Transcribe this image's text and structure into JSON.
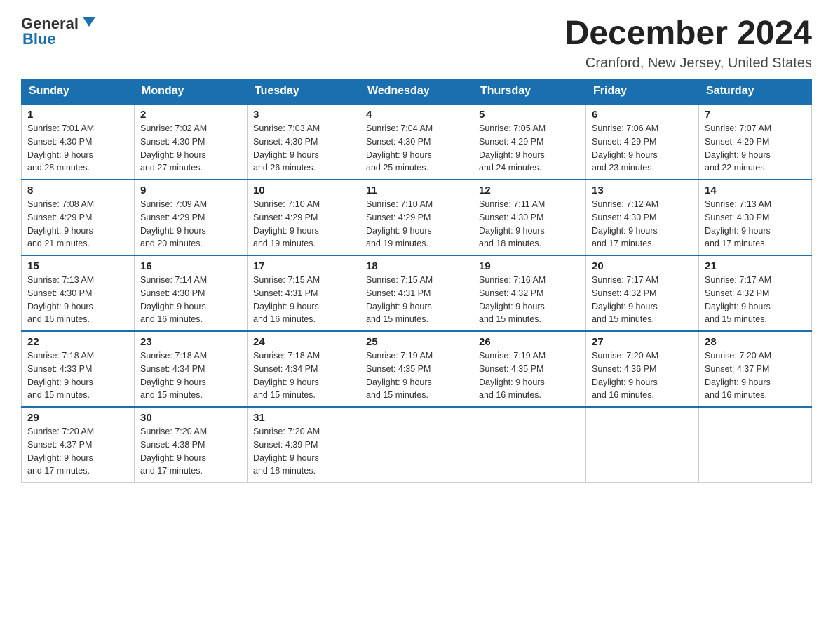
{
  "logo": {
    "general": "General",
    "blue": "Blue"
  },
  "title": "December 2024",
  "location": "Cranford, New Jersey, United States",
  "days_of_week": [
    "Sunday",
    "Monday",
    "Tuesday",
    "Wednesday",
    "Thursday",
    "Friday",
    "Saturday"
  ],
  "weeks": [
    [
      {
        "day": "1",
        "sunrise": "Sunrise: 7:01 AM",
        "sunset": "Sunset: 4:30 PM",
        "daylight": "Daylight: 9 hours",
        "daylight2": "and 28 minutes."
      },
      {
        "day": "2",
        "sunrise": "Sunrise: 7:02 AM",
        "sunset": "Sunset: 4:30 PM",
        "daylight": "Daylight: 9 hours",
        "daylight2": "and 27 minutes."
      },
      {
        "day": "3",
        "sunrise": "Sunrise: 7:03 AM",
        "sunset": "Sunset: 4:30 PM",
        "daylight": "Daylight: 9 hours",
        "daylight2": "and 26 minutes."
      },
      {
        "day": "4",
        "sunrise": "Sunrise: 7:04 AM",
        "sunset": "Sunset: 4:30 PM",
        "daylight": "Daylight: 9 hours",
        "daylight2": "and 25 minutes."
      },
      {
        "day": "5",
        "sunrise": "Sunrise: 7:05 AM",
        "sunset": "Sunset: 4:29 PM",
        "daylight": "Daylight: 9 hours",
        "daylight2": "and 24 minutes."
      },
      {
        "day": "6",
        "sunrise": "Sunrise: 7:06 AM",
        "sunset": "Sunset: 4:29 PM",
        "daylight": "Daylight: 9 hours",
        "daylight2": "and 23 minutes."
      },
      {
        "day": "7",
        "sunrise": "Sunrise: 7:07 AM",
        "sunset": "Sunset: 4:29 PM",
        "daylight": "Daylight: 9 hours",
        "daylight2": "and 22 minutes."
      }
    ],
    [
      {
        "day": "8",
        "sunrise": "Sunrise: 7:08 AM",
        "sunset": "Sunset: 4:29 PM",
        "daylight": "Daylight: 9 hours",
        "daylight2": "and 21 minutes."
      },
      {
        "day": "9",
        "sunrise": "Sunrise: 7:09 AM",
        "sunset": "Sunset: 4:29 PM",
        "daylight": "Daylight: 9 hours",
        "daylight2": "and 20 minutes."
      },
      {
        "day": "10",
        "sunrise": "Sunrise: 7:10 AM",
        "sunset": "Sunset: 4:29 PM",
        "daylight": "Daylight: 9 hours",
        "daylight2": "and 19 minutes."
      },
      {
        "day": "11",
        "sunrise": "Sunrise: 7:10 AM",
        "sunset": "Sunset: 4:29 PM",
        "daylight": "Daylight: 9 hours",
        "daylight2": "and 19 minutes."
      },
      {
        "day": "12",
        "sunrise": "Sunrise: 7:11 AM",
        "sunset": "Sunset: 4:30 PM",
        "daylight": "Daylight: 9 hours",
        "daylight2": "and 18 minutes."
      },
      {
        "day": "13",
        "sunrise": "Sunrise: 7:12 AM",
        "sunset": "Sunset: 4:30 PM",
        "daylight": "Daylight: 9 hours",
        "daylight2": "and 17 minutes."
      },
      {
        "day": "14",
        "sunrise": "Sunrise: 7:13 AM",
        "sunset": "Sunset: 4:30 PM",
        "daylight": "Daylight: 9 hours",
        "daylight2": "and 17 minutes."
      }
    ],
    [
      {
        "day": "15",
        "sunrise": "Sunrise: 7:13 AM",
        "sunset": "Sunset: 4:30 PM",
        "daylight": "Daylight: 9 hours",
        "daylight2": "and 16 minutes."
      },
      {
        "day": "16",
        "sunrise": "Sunrise: 7:14 AM",
        "sunset": "Sunset: 4:30 PM",
        "daylight": "Daylight: 9 hours",
        "daylight2": "and 16 minutes."
      },
      {
        "day": "17",
        "sunrise": "Sunrise: 7:15 AM",
        "sunset": "Sunset: 4:31 PM",
        "daylight": "Daylight: 9 hours",
        "daylight2": "and 16 minutes."
      },
      {
        "day": "18",
        "sunrise": "Sunrise: 7:15 AM",
        "sunset": "Sunset: 4:31 PM",
        "daylight": "Daylight: 9 hours",
        "daylight2": "and 15 minutes."
      },
      {
        "day": "19",
        "sunrise": "Sunrise: 7:16 AM",
        "sunset": "Sunset: 4:32 PM",
        "daylight": "Daylight: 9 hours",
        "daylight2": "and 15 minutes."
      },
      {
        "day": "20",
        "sunrise": "Sunrise: 7:17 AM",
        "sunset": "Sunset: 4:32 PM",
        "daylight": "Daylight: 9 hours",
        "daylight2": "and 15 minutes."
      },
      {
        "day": "21",
        "sunrise": "Sunrise: 7:17 AM",
        "sunset": "Sunset: 4:32 PM",
        "daylight": "Daylight: 9 hours",
        "daylight2": "and 15 minutes."
      }
    ],
    [
      {
        "day": "22",
        "sunrise": "Sunrise: 7:18 AM",
        "sunset": "Sunset: 4:33 PM",
        "daylight": "Daylight: 9 hours",
        "daylight2": "and 15 minutes."
      },
      {
        "day": "23",
        "sunrise": "Sunrise: 7:18 AM",
        "sunset": "Sunset: 4:34 PM",
        "daylight": "Daylight: 9 hours",
        "daylight2": "and 15 minutes."
      },
      {
        "day": "24",
        "sunrise": "Sunrise: 7:18 AM",
        "sunset": "Sunset: 4:34 PM",
        "daylight": "Daylight: 9 hours",
        "daylight2": "and 15 minutes."
      },
      {
        "day": "25",
        "sunrise": "Sunrise: 7:19 AM",
        "sunset": "Sunset: 4:35 PM",
        "daylight": "Daylight: 9 hours",
        "daylight2": "and 15 minutes."
      },
      {
        "day": "26",
        "sunrise": "Sunrise: 7:19 AM",
        "sunset": "Sunset: 4:35 PM",
        "daylight": "Daylight: 9 hours",
        "daylight2": "and 16 minutes."
      },
      {
        "day": "27",
        "sunrise": "Sunrise: 7:20 AM",
        "sunset": "Sunset: 4:36 PM",
        "daylight": "Daylight: 9 hours",
        "daylight2": "and 16 minutes."
      },
      {
        "day": "28",
        "sunrise": "Sunrise: 7:20 AM",
        "sunset": "Sunset: 4:37 PM",
        "daylight": "Daylight: 9 hours",
        "daylight2": "and 16 minutes."
      }
    ],
    [
      {
        "day": "29",
        "sunrise": "Sunrise: 7:20 AM",
        "sunset": "Sunset: 4:37 PM",
        "daylight": "Daylight: 9 hours",
        "daylight2": "and 17 minutes."
      },
      {
        "day": "30",
        "sunrise": "Sunrise: 7:20 AM",
        "sunset": "Sunset: 4:38 PM",
        "daylight": "Daylight: 9 hours",
        "daylight2": "and 17 minutes."
      },
      {
        "day": "31",
        "sunrise": "Sunrise: 7:20 AM",
        "sunset": "Sunset: 4:39 PM",
        "daylight": "Daylight: 9 hours",
        "daylight2": "and 18 minutes."
      },
      null,
      null,
      null,
      null
    ]
  ]
}
